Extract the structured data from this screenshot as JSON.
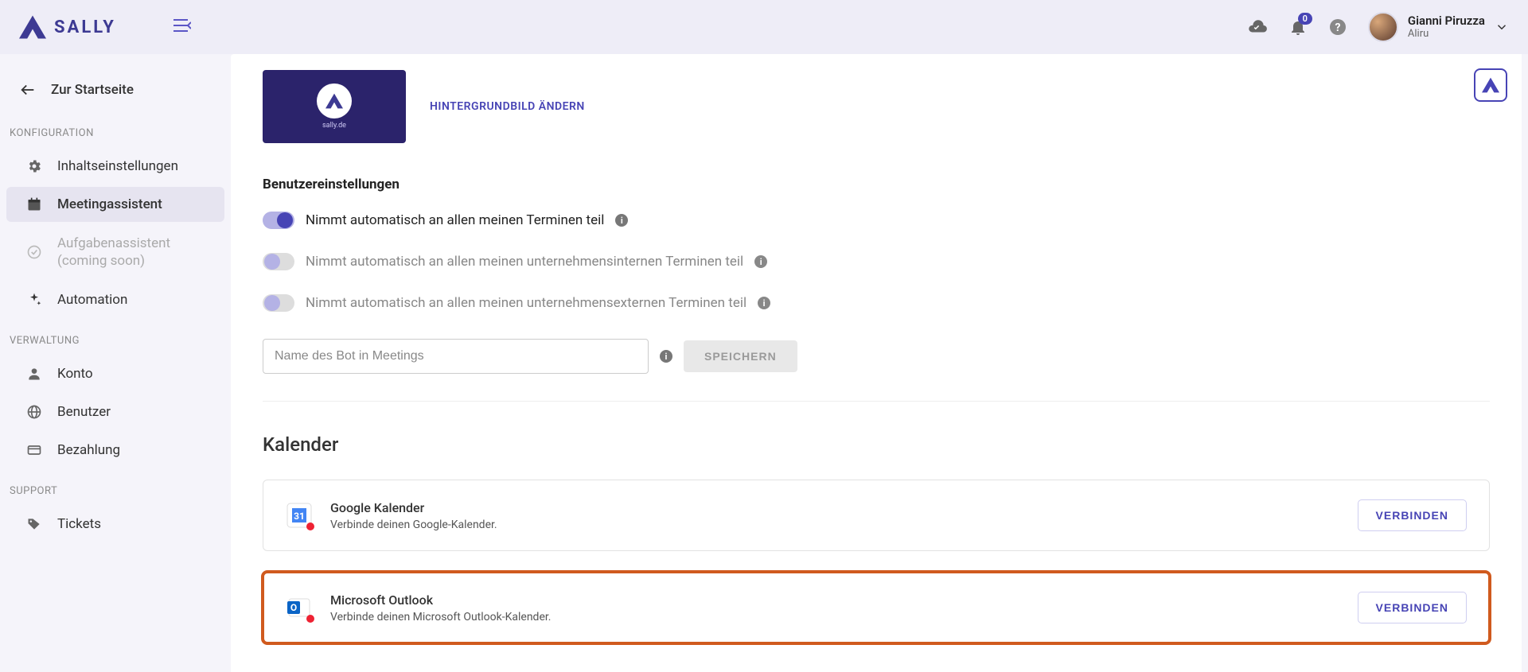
{
  "brand": {
    "name": "SALLY",
    "thumb_text": "sally.de"
  },
  "topbar": {
    "notifications_count": "0",
    "user_name": "Gianni Piruzza",
    "user_org": "Aliru"
  },
  "sidebar": {
    "back_label": "Zur Startseite",
    "sections": {
      "config_label": "KONFIGURATION",
      "admin_label": "VERWALTUNG",
      "support_label": "SUPPORT"
    },
    "items": {
      "content_settings": "Inhaltseinstellungen",
      "meeting_assistant": "Meetingassistent",
      "task_assistant_line1": "Aufgabenassistent",
      "task_assistant_line2": "(coming soon)",
      "automation": "Automation",
      "account": "Konto",
      "users": "Benutzer",
      "billing": "Bezahlung",
      "tickets": "Tickets"
    }
  },
  "main": {
    "bg_change_label": "HINTERGRUNDBILD ÄNDERN",
    "user_settings_title": "Benutzereinstellungen",
    "toggles": {
      "all_meetings": "Nimmt automatisch an allen meinen Terminen teil",
      "internal_meetings": "Nimmt automatisch an allen meinen unternehmensinternen Terminen teil",
      "external_meetings": "Nimmt automatisch an allen meinen unternehmensexternen Terminen teil"
    },
    "botname_placeholder": "Name des Bot in Meetings",
    "save_label": "SPEICHERN",
    "calendar_heading": "Kalender",
    "calendars": {
      "google": {
        "title": "Google Kalender",
        "desc": "Verbinde deinen Google-Kalender.",
        "button": "VERBINDEN"
      },
      "outlook": {
        "title": "Microsoft Outlook",
        "desc": "Verbinde deinen Microsoft Outlook-Kalender.",
        "button": "VERBINDEN"
      }
    }
  }
}
